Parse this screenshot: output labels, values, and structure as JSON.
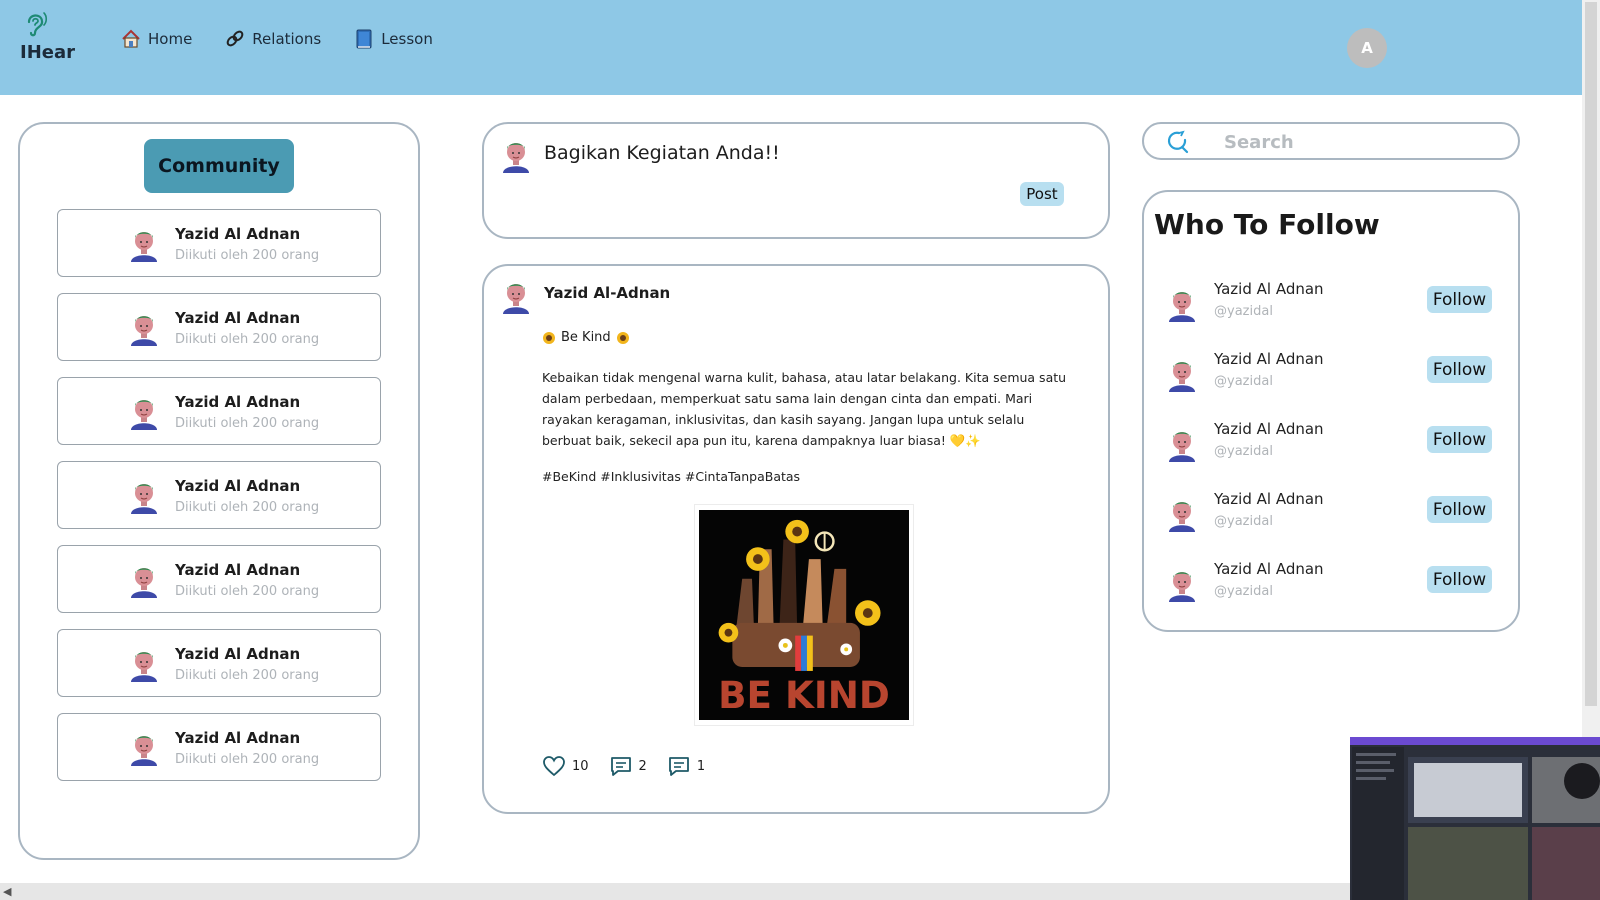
{
  "header": {
    "brand_name": "IHear",
    "nav": [
      {
        "label": "Home",
        "icon": "home-icon"
      },
      {
        "label": "Relations",
        "icon": "link-icon"
      },
      {
        "label": "Lesson",
        "icon": "book-icon"
      }
    ],
    "avatar_initial": "A"
  },
  "community": {
    "button_label": "Community",
    "items": [
      {
        "name": "Yazid Al Adnan",
        "followers": "Diikuti oleh 200 orang"
      },
      {
        "name": "Yazid Al Adnan",
        "followers": "Diikuti oleh 200 orang"
      },
      {
        "name": "Yazid Al Adnan",
        "followers": "Diikuti oleh 200 orang"
      },
      {
        "name": "Yazid Al Adnan",
        "followers": "Diikuti oleh 200 orang"
      },
      {
        "name": "Yazid Al Adnan",
        "followers": "Diikuti oleh 200 orang"
      },
      {
        "name": "Yazid Al Adnan",
        "followers": "Diikuti oleh 200 orang"
      },
      {
        "name": "Yazid Al Adnan",
        "followers": "Diikuti oleh 200 orang"
      }
    ]
  },
  "composer": {
    "prompt": "Bagikan Kegiatan Anda!!",
    "post_label": "Post"
  },
  "post": {
    "author": "Yazid Al-Adnan",
    "title": "Be Kind",
    "body": "Kebaikan tidak mengenal warna kulit, bahasa, atau latar belakang. Kita semua satu dalam perbedaan, memperkuat satu sama lain dengan cinta dan empati. Mari rayakan keragaman, inklusivitas, dan kasih sayang. Jangan lupa untuk selalu berbuat baik, sekecil apa pun itu, karena dampaknya luar biasa! 💛✨",
    "tags": "#BeKind #Inklusivitas #CintaTanpaBatas",
    "image_text": "BE KIND",
    "likes": "10",
    "comments": "2",
    "replies": "1"
  },
  "search": {
    "placeholder": "Search"
  },
  "who_to_follow": {
    "title": "Who To Follow",
    "follow_label": "Follow",
    "users": [
      {
        "name": "Yazid Al Adnan",
        "handle": "@yazidal"
      },
      {
        "name": "Yazid Al Adnan",
        "handle": "@yazidal"
      },
      {
        "name": "Yazid Al Adnan",
        "handle": "@yazidal"
      },
      {
        "name": "Yazid Al Adnan",
        "handle": "@yazidal"
      },
      {
        "name": "Yazid Al Adnan",
        "handle": "@yazidal"
      }
    ]
  },
  "colors": {
    "header_bg": "#8ec8e6",
    "community_button": "#4b9bb3",
    "soft_button": "#b8dff0",
    "panel_border": "#a9b6c2"
  }
}
